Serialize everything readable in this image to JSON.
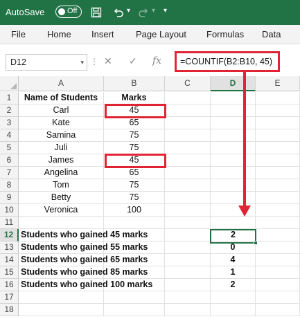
{
  "titlebar": {
    "autosave_label": "AutoSave",
    "toggle_state": "Off",
    "icons": [
      "save-icon",
      "undo-icon",
      "redo-icon",
      "customize-toolbar-icon"
    ]
  },
  "ribbon": {
    "tabs": [
      "File",
      "Home",
      "Insert",
      "Page Layout",
      "Formulas",
      "Data"
    ]
  },
  "formula_bar": {
    "name_box": "D12",
    "cancel_symbol": "✕",
    "enter_symbol": "✓",
    "fx_symbol": "fx",
    "formula": "=COUNTIF(B2:B10, 45)"
  },
  "grid": {
    "columns": [
      "A",
      "B",
      "C",
      "D",
      "E"
    ],
    "selected_column": "D",
    "rows": [
      "1",
      "2",
      "3",
      "4",
      "5",
      "6",
      "7",
      "8",
      "9",
      "10",
      "11",
      "12",
      "13",
      "14",
      "15",
      "16",
      "17",
      "18"
    ],
    "selected_row": "12",
    "header": {
      "name": "Name of Students",
      "marks": "Marks"
    },
    "students": [
      {
        "name": "Carl",
        "marks": "45"
      },
      {
        "name": "Kate",
        "marks": "65"
      },
      {
        "name": "Samina",
        "marks": "75"
      },
      {
        "name": "Juli",
        "marks": "75"
      },
      {
        "name": "James",
        "marks": "45"
      },
      {
        "name": "Angelina",
        "marks": "65"
      },
      {
        "name": "Tom",
        "marks": "75"
      },
      {
        "name": "Betty",
        "marks": "75"
      },
      {
        "name": "Veronica",
        "marks": "100"
      }
    ],
    "summary": [
      {
        "label": "Students who gained 45 marks",
        "count": "2"
      },
      {
        "label": "Students who gained 55 marks",
        "count": "0"
      },
      {
        "label": "Students who gained 65 marks",
        "count": "4"
      },
      {
        "label": "Students who gained 85 marks",
        "count": "1"
      },
      {
        "label": "Students who gained 100 marks",
        "count": "2"
      }
    ]
  },
  "colors": {
    "excel_green": "#217346",
    "highlight_red": "#e02434"
  }
}
